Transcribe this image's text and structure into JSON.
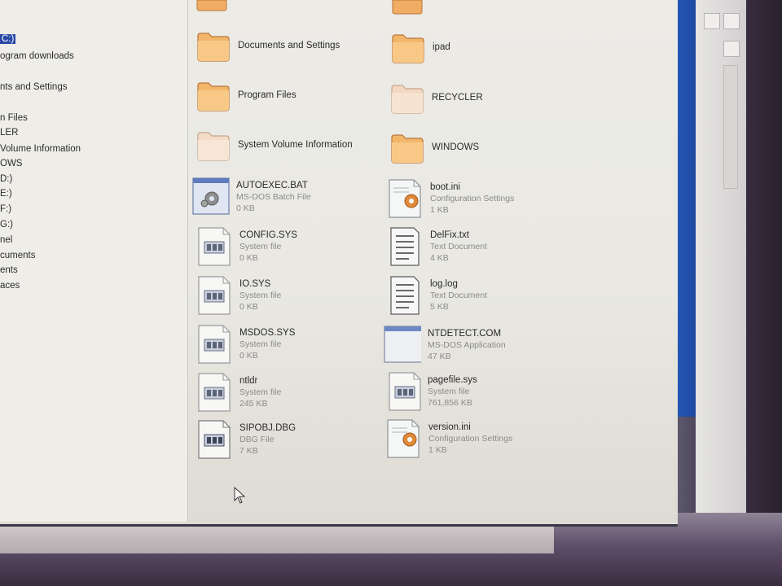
{
  "tree": {
    "items": [
      {
        "label": "C:)",
        "selected": true
      },
      {
        "label": "ogram downloads"
      },
      {
        "label": "nts and Settings"
      },
      {
        "label": "n Files"
      },
      {
        "label": "LER"
      },
      {
        "label": "Volume Information"
      },
      {
        "label": "OWS"
      },
      {
        "label": "D:)"
      },
      {
        "label": "E:)"
      },
      {
        "label": "F:)"
      },
      {
        "label": "G:)"
      },
      {
        "label": "nel"
      },
      {
        "label": "cuments"
      },
      {
        "label": "ents"
      },
      {
        "label": "aces"
      }
    ]
  },
  "folders": [
    {
      "name": "Documents and Settings",
      "icon": "folder-icon"
    },
    {
      "name": "ipad",
      "icon": "folder-icon"
    },
    {
      "name": "Program Files",
      "icon": "folder-icon"
    },
    {
      "name": "RECYCLER",
      "icon": "folder-icon-faded"
    },
    {
      "name": "System Volume Information",
      "icon": "folder-icon-faded"
    },
    {
      "name": "WINDOWS",
      "icon": "folder-icon"
    }
  ],
  "files": [
    {
      "name": "AUTOEXEC.BAT",
      "type": "MS-DOS Batch File",
      "size": "0 KB",
      "icon": "batch-file-icon"
    },
    {
      "name": "boot.ini",
      "type": "Configuration Settings",
      "size": "1 KB",
      "icon": "config-file-icon"
    },
    {
      "name": "CONFIG.SYS",
      "type": "System file",
      "size": "0 KB",
      "icon": "system-file-icon"
    },
    {
      "name": "DelFix.txt",
      "type": "Text Document",
      "size": "4 KB",
      "icon": "text-file-icon"
    },
    {
      "name": "IO.SYS",
      "type": "System file",
      "size": "0 KB",
      "icon": "system-file-icon"
    },
    {
      "name": "log.log",
      "type": "Text Document",
      "size": "5 KB",
      "icon": "text-file-icon"
    },
    {
      "name": "MSDOS.SYS",
      "type": "System file",
      "size": "0 KB",
      "icon": "system-file-icon"
    },
    {
      "name": "NTDETECT.COM",
      "type": "MS-DOS Application",
      "size": "47 KB",
      "icon": "dos-app-icon"
    },
    {
      "name": "ntldr",
      "type": "System file",
      "size": "245 KB",
      "icon": "system-file-icon"
    },
    {
      "name": "pagefile.sys",
      "type": "System file",
      "size": "761,856 KB",
      "icon": "system-file-icon"
    },
    {
      "name": "SIPOBJ.DBG",
      "type": "DBG File",
      "size": "7 KB",
      "icon": "system-file-icon"
    },
    {
      "name": "version.ini",
      "type": "Configuration Settings",
      "size": "1 KB",
      "icon": "config-file-icon"
    }
  ],
  "colors": {
    "selection": "#2a4aa6",
    "folder": "#f2b66b",
    "blue_panel": "#2458b8"
  }
}
